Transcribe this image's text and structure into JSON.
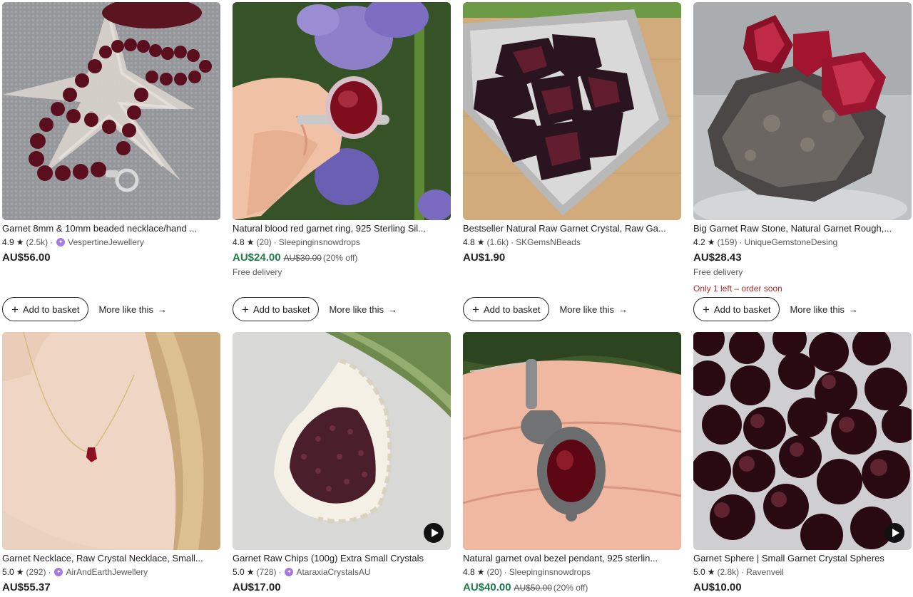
{
  "row1": [
    {
      "title": "Garnet 8mm & 10mm beaded necklace/hand ...",
      "rating": "4.9",
      "reviews": "(2.5k)",
      "star_seller": true,
      "shop": "VespertineJewellery",
      "price": "AU$56.00",
      "original_price": "",
      "discount": "",
      "note": "",
      "urgent": ""
    },
    {
      "title": "Natural blood red garnet ring, 925 Sterling Sil...",
      "rating": "4.8",
      "reviews": "(20)",
      "star_seller": false,
      "shop": "Sleepinginsnowdrops",
      "price": "AU$24.00",
      "original_price": "AU$30.00",
      "discount": "(20% off)",
      "note": "Free delivery",
      "urgent": ""
    },
    {
      "title": "Bestseller Natural Raw Garnet Crystal, Raw Ga...",
      "rating": "4.8",
      "reviews": "(1.6k)",
      "star_seller": false,
      "shop": "SKGemsNBeads",
      "price": "AU$1.90",
      "original_price": "",
      "discount": "",
      "note": "",
      "urgent": ""
    },
    {
      "title": "Big Garnet Raw Stone, Natural Garnet Rough,...",
      "rating": "4.2",
      "reviews": "(159)",
      "star_seller": false,
      "shop": "UniqueGemstoneDesing",
      "price": "AU$28.43",
      "original_price": "",
      "discount": "",
      "note": "Free delivery",
      "urgent": "Only 1 left – order soon"
    }
  ],
  "row2": [
    {
      "title": "Garnet Necklace, Raw Crystal Necklace, Small...",
      "rating": "5.0",
      "reviews": "(292)",
      "star_seller": true,
      "shop": "AirAndEarthJewellery",
      "price": "AU$55.37",
      "original_price": "",
      "discount": ""
    },
    {
      "title": "Garnet Raw Chips (100g) Extra Small Crystals",
      "rating": "5.0",
      "reviews": "(728)",
      "star_seller": true,
      "shop": "AtaraxiaCrystalsAU",
      "price": "AU$17.00",
      "original_price": "",
      "discount": ""
    },
    {
      "title": "Natural garnet oval bezel pendant, 925 sterlin...",
      "rating": "4.8",
      "reviews": "(20)",
      "star_seller": false,
      "shop": "Sleepinginsnowdrops",
      "price": "AU$40.00",
      "original_price": "AU$50.00",
      "discount": "(20% off)"
    },
    {
      "title": "Garnet Sphere | Small Garnet Crystal Spheres",
      "rating": "5.0",
      "reviews": "(2.8k)",
      "star_seller": false,
      "shop": "Ravenveil",
      "price": "AU$10.00",
      "original_price": "",
      "discount": ""
    }
  ],
  "actions": {
    "add_to_basket": "Add to basket",
    "more_like_this": "More like this",
    "plus_icon": "+",
    "arrow_icon": "→"
  },
  "glyphs": {
    "star": "★",
    "dot": "·",
    "star_seller_badge": "✦"
  },
  "colors": {
    "sale_price": "#1f7b4d",
    "urgent": "#b12a2a",
    "star_seller_badge": "#a77ae0"
  }
}
